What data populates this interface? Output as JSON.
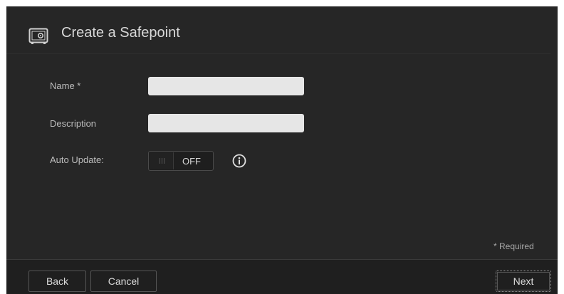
{
  "dialog": {
    "title": "Create a Safepoint",
    "title_icon": "safe-icon"
  },
  "form": {
    "name": {
      "label": "Name *",
      "value": "",
      "placeholder": ""
    },
    "description": {
      "label": "Description",
      "value": "",
      "placeholder": ""
    },
    "auto_update": {
      "label": "Auto Update:",
      "state": "OFF",
      "info_icon": "info-icon"
    }
  },
  "required_note": "* Required",
  "footer": {
    "back_label": "Back",
    "cancel_label": "Cancel",
    "next_label": "Next"
  },
  "colors": {
    "panel_background": "#262626",
    "footer_background": "#1f1f1f",
    "input_background": "#e6e6e6",
    "text": "#d8d8d8"
  }
}
